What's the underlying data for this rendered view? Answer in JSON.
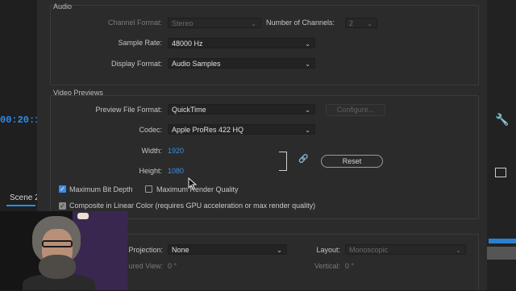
{
  "background": {
    "timecode": "00:20:1",
    "scene_tab": "Scene 2"
  },
  "audio": {
    "title": "Audio",
    "channel_format_label": "Channel Format:",
    "channel_format_value": "Stereo",
    "num_channels_label": "Number of Channels:",
    "num_channels_value": "2",
    "sample_rate_label": "Sample Rate:",
    "sample_rate_value": "48000 Hz",
    "display_format_label": "Display Format:",
    "display_format_value": "Audio Samples"
  },
  "video_previews": {
    "title": "Video Previews",
    "file_format_label": "Preview File Format:",
    "file_format_value": "QuickTime",
    "configure_label": "Configure...",
    "codec_label": "Codec:",
    "codec_value": "Apple ProRes 422 HQ",
    "width_label": "Width:",
    "width_value": "1920",
    "height_label": "Height:",
    "height_value": "1080",
    "reset_label": "Reset",
    "max_bit_depth_label": "Maximum Bit Depth",
    "max_bit_depth_checked": true,
    "max_render_quality_label": "Maximum Render Quality",
    "max_render_quality_checked": false,
    "linear_color_label": "Composite in Linear Color (requires GPU acceleration or max render quality)",
    "linear_color_checked": true
  },
  "vr": {
    "projection_label": "Projection:",
    "projection_value": "None",
    "layout_label": "Layout:",
    "layout_value": "Monoscopic",
    "captured_view_label": "ured View:",
    "captured_view_value": "0 °",
    "vertical_label": "Vertical:",
    "vertical_value": "0 °"
  },
  "icons": [
    "chevron-down-icon",
    "link-icon",
    "wrench-icon",
    "checkmark-icon",
    "cursor-icon"
  ],
  "colors": {
    "accent": "#3a8ee6",
    "value_blue": "#3e8ede",
    "dialog_bg": "#2b2b2b"
  }
}
